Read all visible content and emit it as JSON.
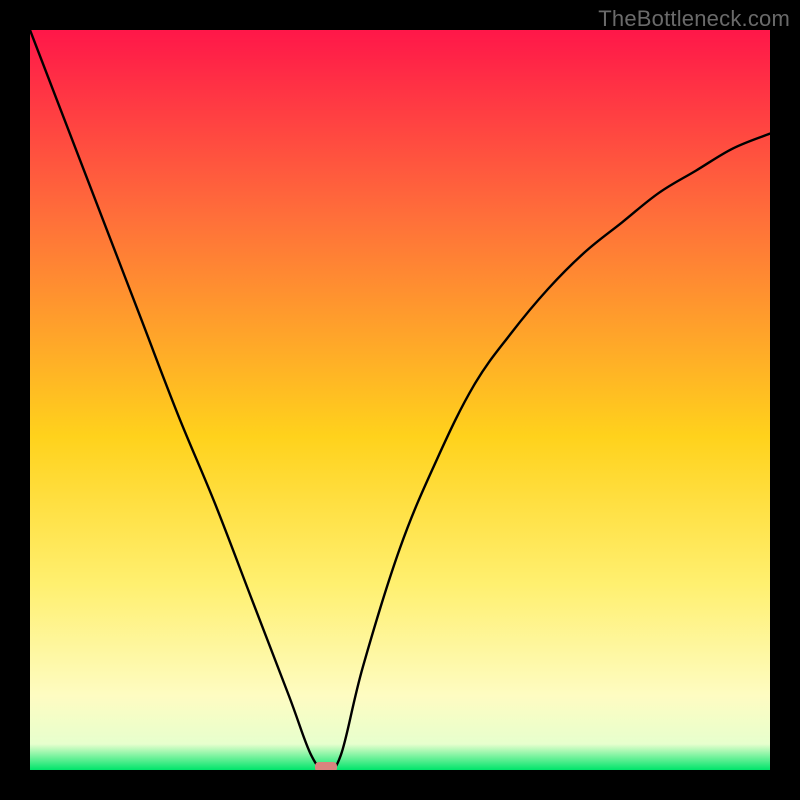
{
  "watermark": "TheBottleneck.com",
  "chart_data": {
    "type": "line",
    "title": "",
    "xlabel": "",
    "ylabel": "",
    "xlim": [
      0,
      100
    ],
    "ylim": [
      0,
      100
    ],
    "grid": false,
    "note": "No axis ticks, labels, or legend are rendered in the image. Y values below are estimated from curve height as a percentage of the plot area (100 = top, 0 = bottom), X as percentage of width.",
    "series": [
      {
        "name": "bottleneck-curve",
        "color": "#000000",
        "x": [
          0,
          5,
          10,
          15,
          20,
          25,
          30,
          35,
          38,
          40,
          42,
          45,
          50,
          55,
          60,
          65,
          70,
          75,
          80,
          85,
          90,
          95,
          100
        ],
        "values": [
          100,
          87,
          74,
          61,
          48,
          36,
          23,
          10,
          2,
          0,
          2,
          14,
          30,
          42,
          52,
          59,
          65,
          70,
          74,
          78,
          81,
          84,
          86
        ]
      }
    ],
    "marker": {
      "name": "min-marker",
      "x": 40,
      "value": 0,
      "color": "#d9847e",
      "note": "Small rounded marker at curve minimum, approx x=40% of width."
    },
    "background": {
      "type": "vertical-gradient",
      "stops": [
        {
          "offset": 0,
          "color": "#ff1749"
        },
        {
          "offset": 0.25,
          "color": "#ff6e3a"
        },
        {
          "offset": 0.55,
          "color": "#ffd21c"
        },
        {
          "offset": 0.75,
          "color": "#fff070"
        },
        {
          "offset": 0.9,
          "color": "#fefcc2"
        },
        {
          "offset": 0.965,
          "color": "#e7ffcd"
        },
        {
          "offset": 1.0,
          "color": "#00e56b"
        }
      ]
    }
  }
}
